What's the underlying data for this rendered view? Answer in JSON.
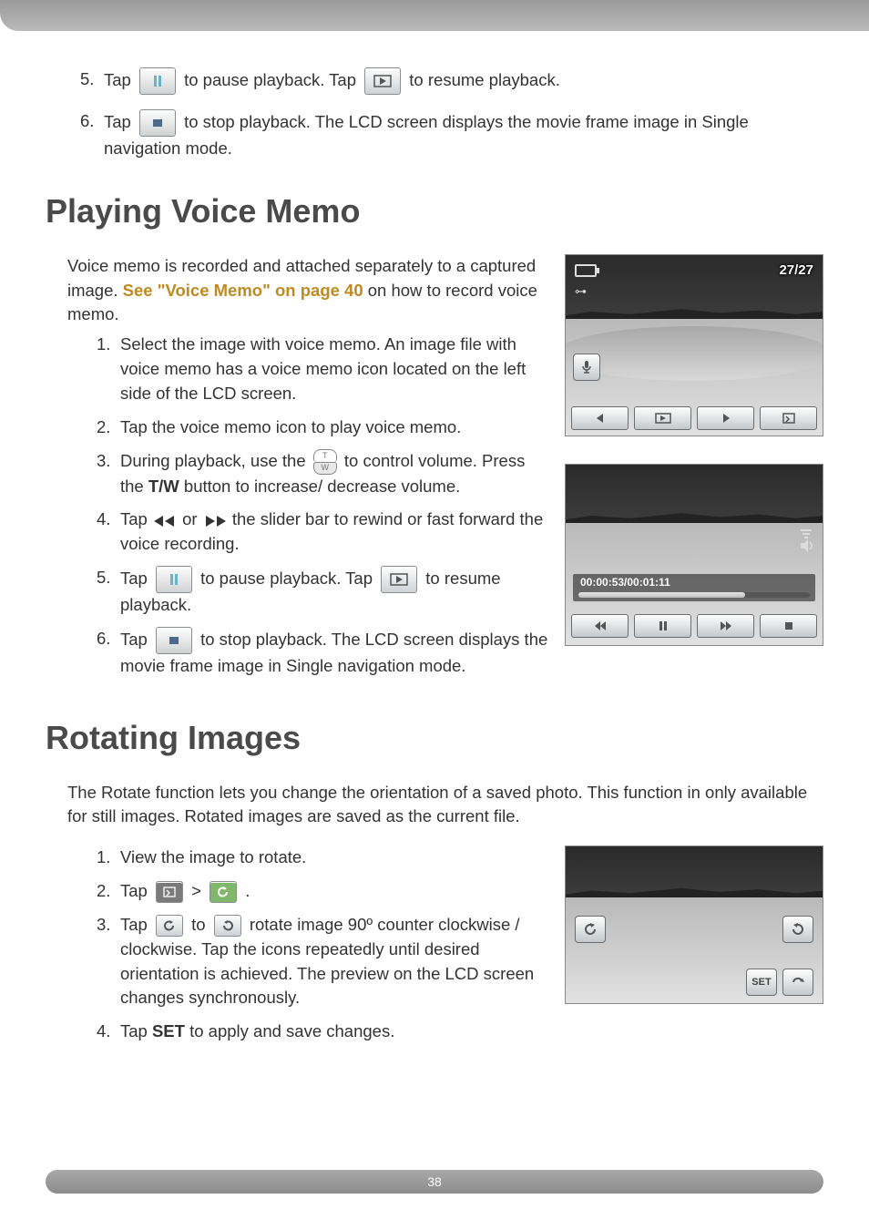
{
  "top_steps": {
    "s5": {
      "num": "5.",
      "t1": "Tap",
      "t2": "to pause playback. Tap",
      "t3": "to resume playback."
    },
    "s6": {
      "num": "6.",
      "t1": "Tap",
      "t2": "to stop playback. The LCD screen displays the movie frame image in Single navigation mode."
    }
  },
  "section1": {
    "heading": "Playing Voice Memo",
    "intro1": "Voice memo is recorded and attached separately to a captured image. ",
    "intro_link": "See \"Voice Memo\" on page 40",
    "intro2": " on how to record voice memo.",
    "steps": {
      "s1": {
        "num": "1.",
        "txt": "Select the image with voice memo. An image file with voice memo has a voice memo icon located on the left side of the LCD screen."
      },
      "s2": {
        "num": "2.",
        "txt": "Tap the voice memo icon to play voice memo."
      },
      "s3": {
        "num": "3.",
        "t1": "During playback, use the",
        "t2": "to control volume. Press the ",
        "bold": "T/W",
        "t3": " button to increase/ decrease volume."
      },
      "s4": {
        "num": "4.",
        "t1": "Tap",
        "t2": "or",
        "t3": "the slider bar to rewind or fast forward the voice recording."
      },
      "s5": {
        "num": "5.",
        "t1": "Tap",
        "t2": "to pause playback. Tap",
        "t3": "to resume playback."
      },
      "s6": {
        "num": "6.",
        "t1": "Tap",
        "t2": "to stop playback. The LCD screen displays the movie frame image in Single navigation mode."
      }
    },
    "screenshot1": {
      "counter": "27/27"
    },
    "screenshot2": {
      "time": "00:00:53/00:01:11"
    }
  },
  "section2": {
    "heading": "Rotating Images",
    "intro": "The Rotate function lets you change the orientation of a saved photo. This function in only available for still images. Rotated images are saved as the current file.",
    "steps": {
      "s1": {
        "num": "1.",
        "txt": "View the image to rotate."
      },
      "s2": {
        "num": "2.",
        "t1": "Tap",
        "gt": ">",
        "dot": "."
      },
      "s3": {
        "num": "3.",
        "t1": "Tap",
        "t2": "to",
        "t3": "rotate image 90º counter clockwise / clockwise. Tap the icons repeatedly until desired orientation is achieved. The preview on the LCD screen changes synchronously."
      },
      "s4": {
        "num": "4.",
        "t1": "Tap ",
        "bold": "SET",
        "t2": " to apply and save changes."
      }
    },
    "screenshot3": {
      "set": "SET"
    }
  },
  "page_number": "38"
}
